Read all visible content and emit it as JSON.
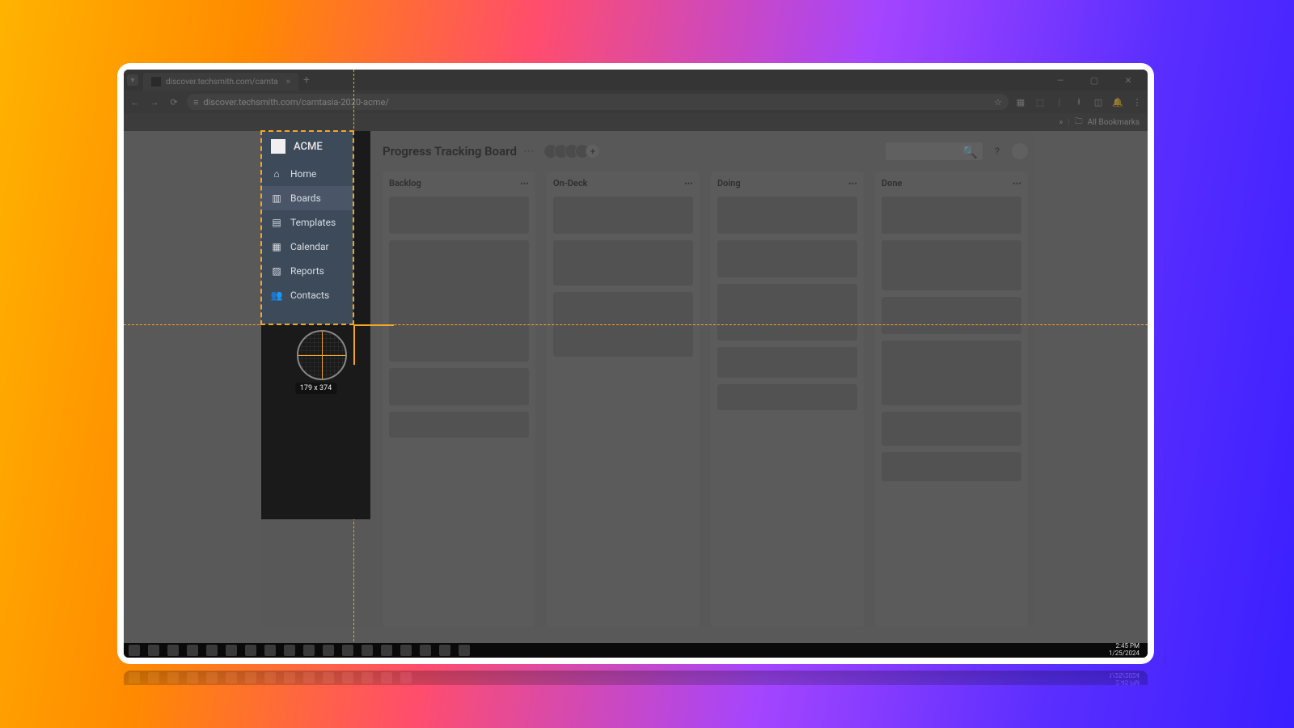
{
  "browser": {
    "tab_title": "discover.techsmith.com/camta",
    "url": "discover.techsmith.com/camtasia-2020-acme/",
    "bookmarks_label": "All Bookmarks",
    "new_tab_glyph": "+",
    "tab_close_glyph": "×",
    "chevron_glyph": "▾",
    "overflow_glyph": "»",
    "back_glyph": "←",
    "forward_glyph": "→",
    "reload_glyph": "⟳",
    "site_glyph": "≡",
    "star_glyph": "☆",
    "ext1_glyph": "▦",
    "ext2_glyph": "⬚",
    "download_glyph": "⭳",
    "panel_glyph": "◫",
    "notif_glyph": "🔔",
    "menu_glyph": "⋮",
    "folder_glyph": "🗀",
    "window_min": "—",
    "window_max": "▢",
    "window_close": "✕"
  },
  "sidebar": {
    "brand": "ACME",
    "items": [
      {
        "label": "Home",
        "icon": "⌂"
      },
      {
        "label": "Boards",
        "icon": "▥"
      },
      {
        "label": "Templates",
        "icon": "▤"
      },
      {
        "label": "Calendar",
        "icon": "▦"
      },
      {
        "label": "Reports",
        "icon": "▨"
      },
      {
        "label": "Contacts",
        "icon": "👥"
      }
    ]
  },
  "board": {
    "title": "Progress Tracking Board",
    "dots": "⋯",
    "search_glyph": "🔍",
    "help_glyph": "?",
    "add_glyph": "+",
    "columns": [
      {
        "name": "Backlog",
        "cards": [
          46,
          150,
          46,
          32
        ]
      },
      {
        "name": "On-Deck",
        "cards": [
          46,
          56,
          80
        ]
      },
      {
        "name": "Doing",
        "cards": [
          46,
          46,
          70,
          38,
          32
        ]
      },
      {
        "name": "Done",
        "cards": [
          46,
          62,
          46,
          80,
          42,
          36
        ]
      }
    ]
  },
  "capture": {
    "dimensions": "179 x 374"
  },
  "taskbar": {
    "time": "2:45 PM",
    "date": "1/25/2024"
  }
}
